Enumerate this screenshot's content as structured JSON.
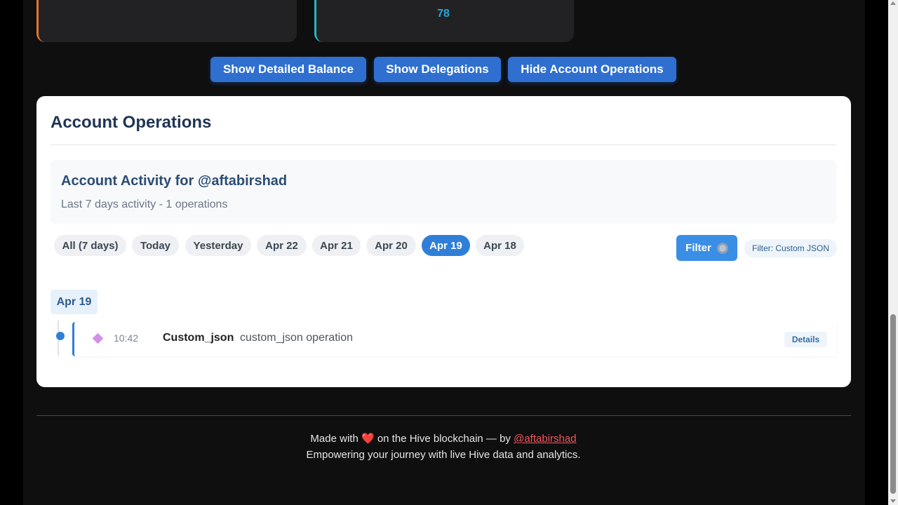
{
  "stats": {
    "right_value": "78"
  },
  "toolbar": {
    "detailed_balance_label": "Show Detailed Balance",
    "delegations_label": "Show Delegations",
    "hide_operations_label": "Hide Account Operations"
  },
  "operations": {
    "title": "Account Operations",
    "activity_title": "Account Activity for @aftabirshad",
    "activity_subtitle": "Last 7 days activity - 1 operations",
    "day_filters": [
      {
        "label": "All (7 days)",
        "active": false
      },
      {
        "label": "Today",
        "active": false
      },
      {
        "label": "Yesterday",
        "active": false
      },
      {
        "label": "Apr 22",
        "active": false
      },
      {
        "label": "Apr 21",
        "active": false
      },
      {
        "label": "Apr 20",
        "active": false
      },
      {
        "label": "Apr 19",
        "active": true
      },
      {
        "label": "Apr 18",
        "active": false
      }
    ],
    "filter_label": "Filter",
    "filter_tag": "Filter: Custom JSON",
    "date_group": "Apr 19",
    "entries": [
      {
        "time": "10:42",
        "type": "Custom_json",
        "description": "custom_json operation",
        "details_label": "Details"
      }
    ]
  },
  "footer": {
    "line1_prefix": "Made with",
    "line1_middle": "on the Hive blockchain — by",
    "author_link": "@aftabirshad",
    "line2": "Empowering your journey with live Hive data and analytics."
  },
  "colors": {
    "primary_button": "#2f6fd0",
    "active_pill": "#2f7fd8",
    "stat_left_accent": "#e0782e",
    "stat_right_accent": "#27b5c4"
  }
}
